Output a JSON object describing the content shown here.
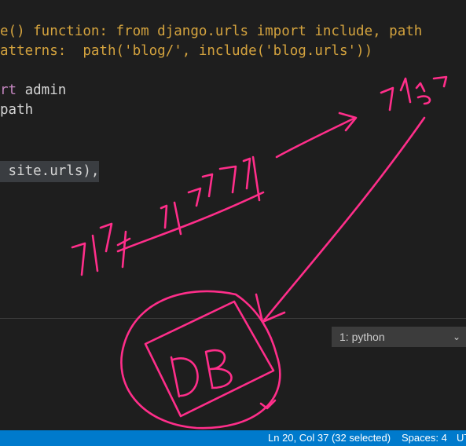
{
  "editor": {
    "lines": [
      {
        "text": "e() function: from django.urls import include, path",
        "kind": "comment"
      },
      {
        "text": "atterns:  path('blog/', include('blog.urls'))",
        "kind": "comment"
      },
      {
        "text_kw": "rt",
        "text_rest": " admin"
      },
      {
        "text": "path"
      },
      {
        "text": " site.urls),"
      }
    ]
  },
  "panel": {
    "terminal_select": "1: python",
    "chevron_icon": "chevron-down-icon"
  },
  "statusbar": {
    "position": "Ln 20, Col 37 (32 selected)",
    "spaces": "Spaces: 4",
    "encoding": "UT"
  },
  "annotation": {
    "ink_color": "#ff2e8a",
    "db_label": "DB"
  }
}
